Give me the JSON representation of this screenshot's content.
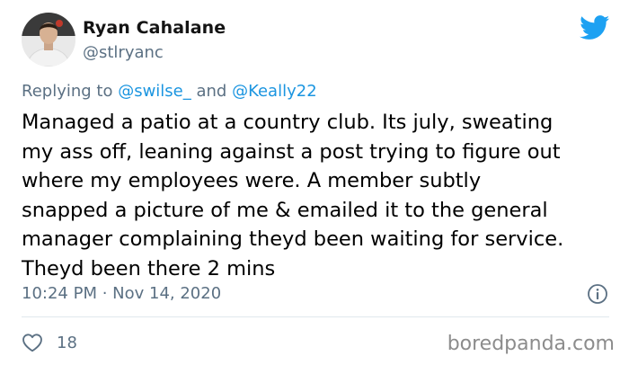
{
  "author": {
    "display_name": "Ryan Cahalane",
    "handle": "@stlryanc",
    "avatar_icon": "user-avatar-photo"
  },
  "reply": {
    "prefix": "Replying to ",
    "mention_1": "@swilse_",
    "joiner": " and ",
    "mention_2": "@Keally22"
  },
  "tweet": {
    "lines": [
      "Managed a patio at a country club. Its july, sweating",
      "my ass off, leaning against a post trying to figure out",
      "where my employees were. A member subtly",
      "snapped a picture of me & emailed it to the general",
      "manager complaining theyd been waiting for service.",
      "Theyd been there 2 mins"
    ],
    "timestamp": "10:24 PM · Nov 14, 2020"
  },
  "actions": {
    "like_count": "18",
    "like_icon": "heart-outline-icon",
    "info_icon": "info-circle-icon"
  },
  "branding": {
    "platform_icon": "twitter-bird-icon",
    "watermark": "boredpanda.com"
  },
  "colors": {
    "twitter_blue": "#1da1f2",
    "mention_blue": "#1b95e0",
    "secondary_text": "#5b7083",
    "divider": "#e1e8ed",
    "watermark_gray": "#8c8c8c"
  }
}
